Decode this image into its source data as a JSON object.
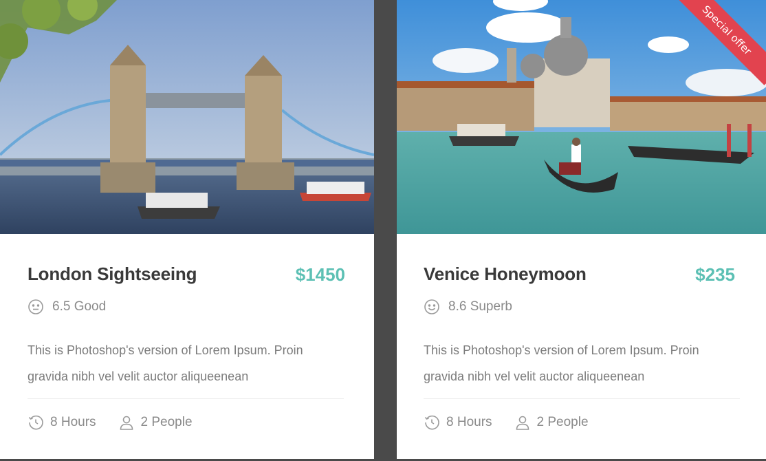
{
  "cards": [
    {
      "title": "London Sightseeing",
      "price": "$1450",
      "rating": "6.5 Good",
      "description_line1": "This is Photoshop's version  of Lorem Ipsum. Proin",
      "description_line2": "gravida nibh vel velit auctor aliqueenean",
      "duration": "8 Hours",
      "people": "2 People",
      "image": "tower-bridge-photo"
    },
    {
      "title": "Venice Honeymoon",
      "price": "$235",
      "rating": "8.6 Superb",
      "description_line1": "This is Photoshop's version  of Lorem Ipsum. Proin",
      "description_line2": "gravida nibh vel velit auctor aliqueenean",
      "duration": "8 Hours",
      "people": "2 People",
      "image": "venice-gondola-photo",
      "badge": "Special offer"
    }
  ],
  "colors": {
    "accent": "#5cc0b4",
    "badge": "#e2434f",
    "title": "#3a3a3a",
    "muted": "#8a8a8a",
    "background": "#4a4a4a"
  }
}
